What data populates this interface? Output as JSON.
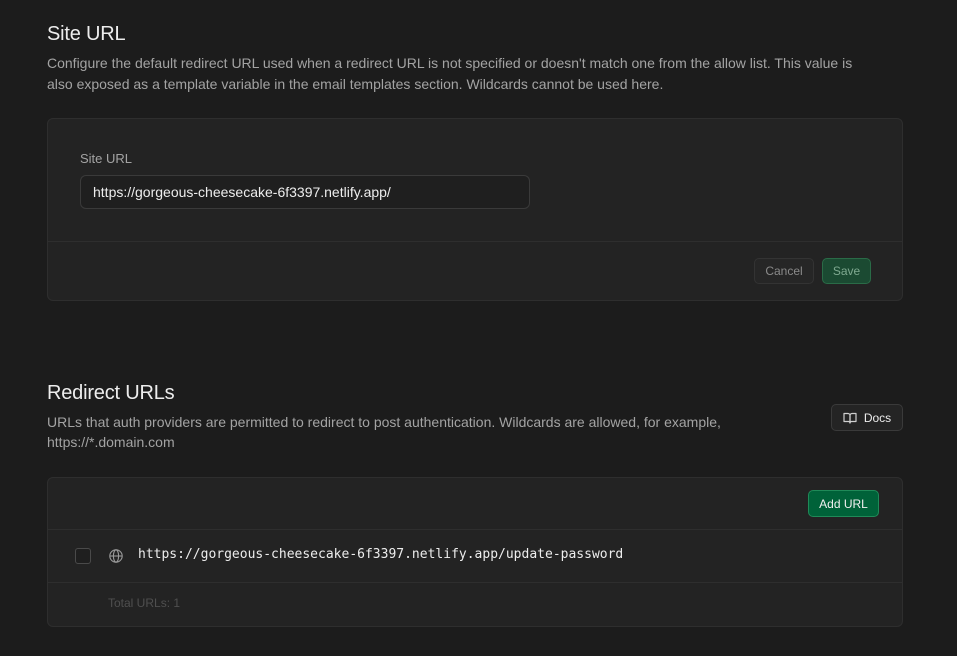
{
  "site_url_section": {
    "title": "Site URL",
    "description_line1": "Configure the default redirect URL used when a redirect URL is not specified or doesn't match one from the allow list. This value is",
    "description_line2": "also exposed as a template variable in the email templates section. Wildcards cannot be used here.",
    "field_label": "Site URL",
    "field_value": "https://gorgeous-cheesecake-6f3397.netlify.app/",
    "cancel_label": "Cancel",
    "save_label": "Save"
  },
  "redirect_section": {
    "title": "Redirect URLs",
    "description_line1": "URLs that auth providers are permitted to redirect to post authentication. Wildcards are allowed, for example,",
    "description_line2": "https://*.domain.com",
    "docs_label": "Docs",
    "add_url_label": "Add URL",
    "urls": [
      {
        "value": "https://gorgeous-cheesecake-6f3397.netlify.app/update-password",
        "icon": "globe-icon"
      }
    ],
    "total_label": "Total URLs: 1"
  },
  "colors": {
    "background": "#1c1c1c",
    "panel": "#232323",
    "accent_green": "#006239",
    "text_primary": "#ededed",
    "text_muted": "#a3a3a3"
  }
}
